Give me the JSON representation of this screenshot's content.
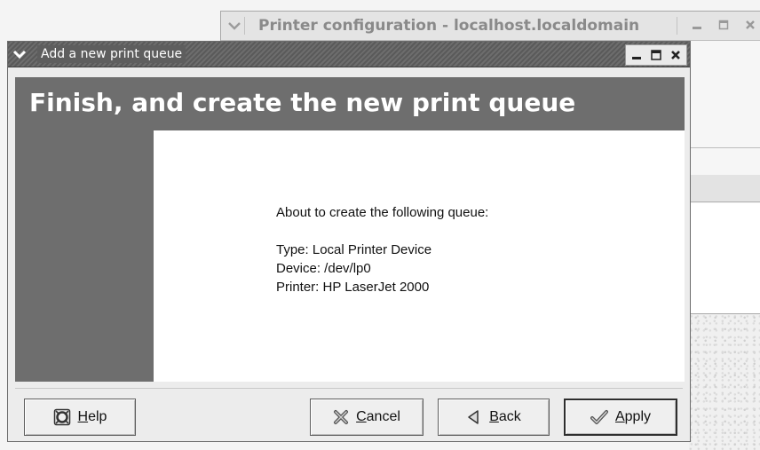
{
  "background_window": {
    "title": "Printer configuration - localhost.localdomain",
    "controls": [
      "minimize-icon",
      "maximize-icon",
      "close-icon"
    ]
  },
  "dialog": {
    "title": "Add a new print queue",
    "controls": [
      "minimize-icon",
      "maximize-icon",
      "close-icon"
    ],
    "banner": "Finish, and create the new print queue",
    "summary": {
      "intro": "About to create the following queue:",
      "type": "Type: Local Printer Device",
      "device": "Device: /dev/lp0",
      "printer": "Printer: HP LaserJet 2000"
    },
    "buttons": {
      "help": {
        "mnemonic": "H",
        "rest": "elp",
        "icon": "help-icon"
      },
      "cancel": {
        "mnemonic": "C",
        "rest": "ancel",
        "icon": "cancel-icon"
      },
      "back": {
        "mnemonic": "B",
        "rest": "ack",
        "icon": "back-arrow-icon"
      },
      "apply": {
        "mnemonic": "A",
        "rest": "pply",
        "icon": "checkmark-icon"
      }
    }
  },
  "colors": {
    "banner": "#6e6e6e",
    "titlebar_active": "#5e5e5e",
    "window_bg": "#ececec"
  }
}
